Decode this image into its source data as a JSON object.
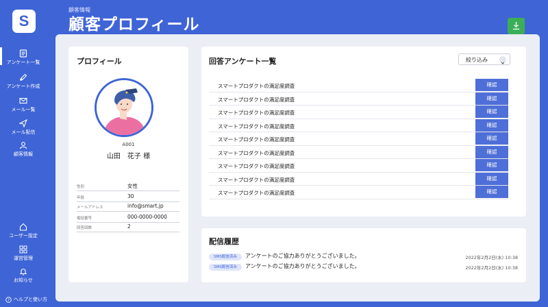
{
  "app": {
    "logo_letter": "S"
  },
  "sidebar": {
    "items": [
      {
        "label": "アンケート一覧",
        "icon": "list-icon"
      },
      {
        "label": "アンケート作成",
        "icon": "edit-icon"
      },
      {
        "label": "メール一覧",
        "icon": "mail-icon"
      },
      {
        "label": "メール配信",
        "icon": "send-icon"
      },
      {
        "label": "顧客情報",
        "icon": "user-icon"
      },
      {
        "label": "ユーザー設定",
        "icon": "home-icon"
      },
      {
        "label": "運営管理",
        "icon": "grid-icon"
      },
      {
        "label": "お知らせ",
        "icon": "bell-icon"
      }
    ],
    "help_label": "ヘルプと使い方"
  },
  "header": {
    "breadcrumb": "顧客情報",
    "title": "顧客プロフィール"
  },
  "profile": {
    "title": "プロフィール",
    "customer_id": "A001",
    "name": "山田　花子 様",
    "fields": [
      {
        "key": "性別",
        "value": "女性"
      },
      {
        "key": "年齢",
        "value": "30"
      },
      {
        "key": "メールアドレス",
        "value": "info@smart.jp"
      },
      {
        "key": "電話番号",
        "value": "000-0000-0000"
      },
      {
        "key": "回答回数",
        "value": "2"
      }
    ]
  },
  "surveys": {
    "title": "回答アンケート一覧",
    "filter_label": "絞り込み",
    "rows": [
      {
        "name": "スマートプロダクトの満足度調査",
        "action": "確認"
      },
      {
        "name": "スマートプロダクトの満足度調査",
        "action": "確認"
      },
      {
        "name": "スマートプロダクトの満足度調査",
        "action": "確認"
      },
      {
        "name": "スマートプロダクトの満足度調査",
        "action": "確認"
      },
      {
        "name": "スマートプロダクトの満足度調査",
        "action": "確認"
      },
      {
        "name": "スマートプロダクトの満足度調査",
        "action": "確認"
      },
      {
        "name": "スマートプロダクトの満足度調査",
        "action": "確認"
      },
      {
        "name": "スマートプロダクトの満足度調査",
        "action": "確認"
      },
      {
        "name": "スマートプロダクトの満足度調査",
        "action": "確認"
      }
    ]
  },
  "delivery": {
    "title": "配信履歴",
    "rows": [
      {
        "badge": "SMS配信済み",
        "message": "アンケートのご協力ありがとうございました。",
        "time": "2022年2月2日(水) 10:38"
      },
      {
        "badge": "SMS配信済み",
        "message": "アンケートのご協力ありがとうございました。",
        "time": "2022年2月2日(水) 10:38"
      }
    ]
  },
  "colors": {
    "brand": "#3f64d6",
    "confirm_button": "#4f6fd8",
    "download_button": "#3cae58"
  }
}
